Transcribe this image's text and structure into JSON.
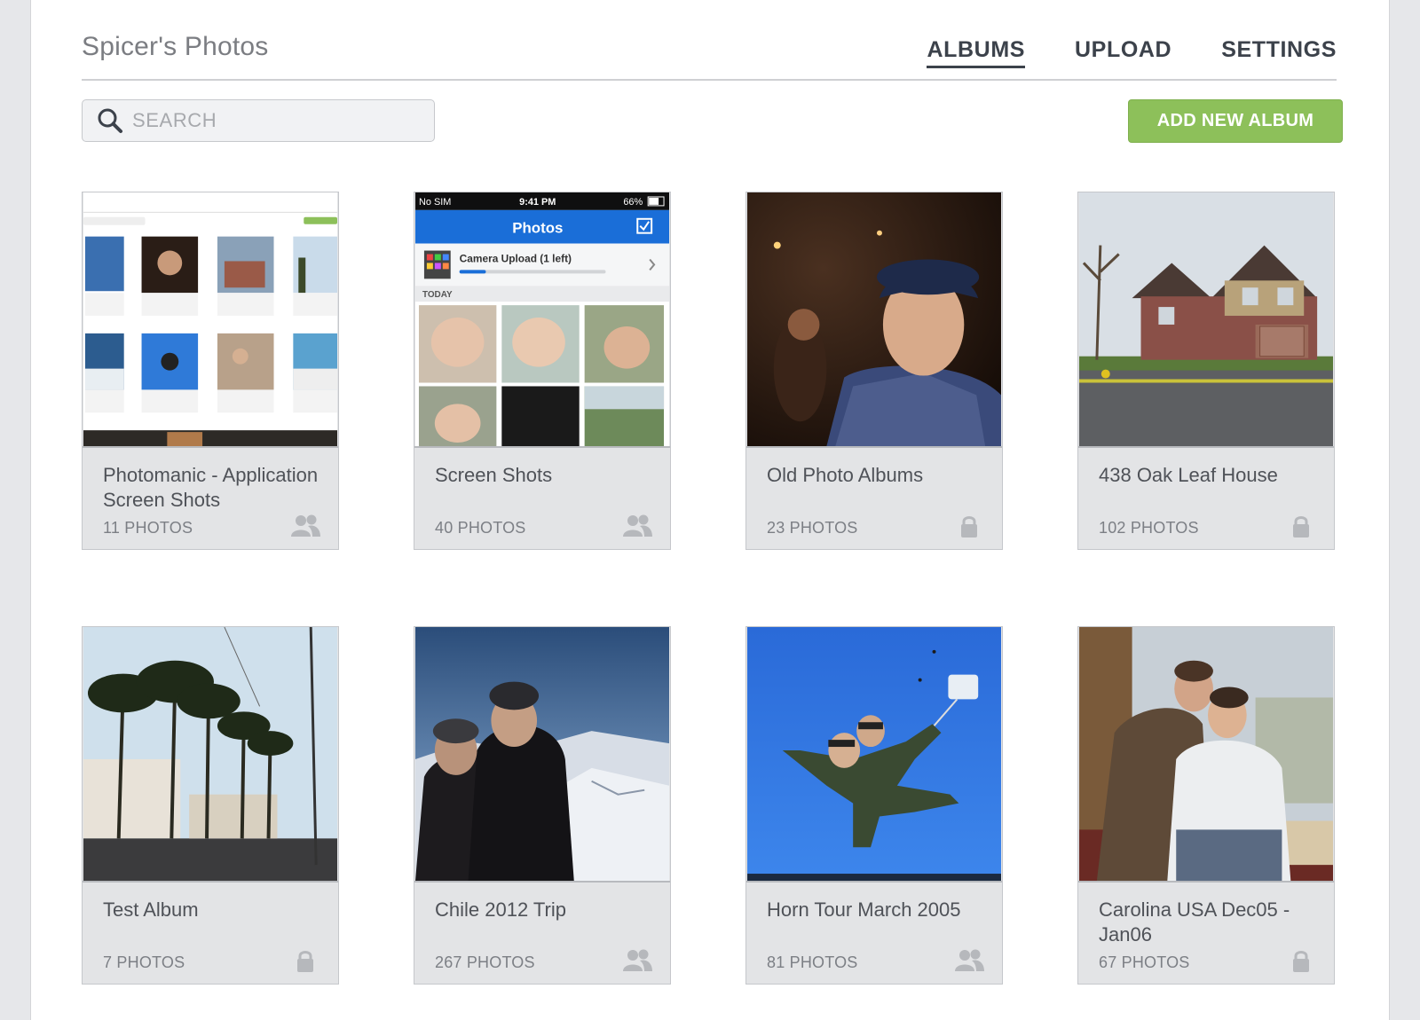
{
  "header": {
    "title": "Spicer's Photos",
    "nav": [
      {
        "label": "ALBUMS",
        "active": true
      },
      {
        "label": "UPLOAD",
        "active": false
      },
      {
        "label": "SETTINGS",
        "active": false
      }
    ]
  },
  "search": {
    "placeholder": "SEARCH",
    "value": ""
  },
  "toolbar": {
    "add_album_label": "ADD NEW ALBUM"
  },
  "colors": {
    "accent": "#8dc05a",
    "nav_text": "#3c424b",
    "card_bg": "#e3e4e6"
  },
  "thumb_screens": {
    "status_carrier": "No SIM",
    "status_time": "9:41 PM",
    "status_battery": "66%",
    "app_title": "Photos",
    "upload_label": "Camera Upload (1 left)",
    "section_label": "TODAY"
  },
  "albums": [
    {
      "title": "Photomanic - Application Screen Shots",
      "count": "11 PHOTOS",
      "privacy": "shared",
      "icon": "people-icon"
    },
    {
      "title": "Screen Shots",
      "count": "40 PHOTOS",
      "privacy": "shared",
      "icon": "people-icon"
    },
    {
      "title": "Old Photo Albums",
      "count": "23 PHOTOS",
      "privacy": "private",
      "icon": "lock-icon"
    },
    {
      "title": "438 Oak Leaf House",
      "count": "102 PHOTOS",
      "privacy": "private",
      "icon": "lock-icon"
    },
    {
      "title": "Test Album",
      "count": "7 PHOTOS",
      "privacy": "private",
      "icon": "lock-icon"
    },
    {
      "title": "Chile 2012 Trip",
      "count": "267 PHOTOS",
      "privacy": "shared",
      "icon": "people-icon"
    },
    {
      "title": "Horn Tour March 2005",
      "count": "81 PHOTOS",
      "privacy": "shared",
      "icon": "people-icon"
    },
    {
      "title": "Carolina USA Dec05 - Jan06",
      "count": "67 PHOTOS",
      "privacy": "private",
      "icon": "lock-icon"
    }
  ]
}
